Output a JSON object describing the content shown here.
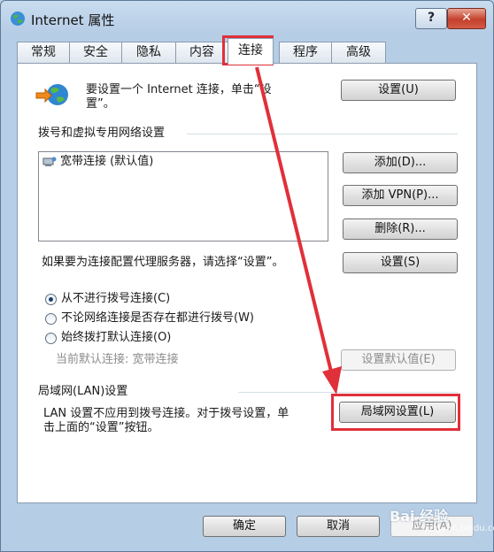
{
  "window": {
    "title": "Internet 属性",
    "help_label": "?",
    "close_label": "✕"
  },
  "tabs": [
    {
      "label": "常规"
    },
    {
      "label": "安全"
    },
    {
      "label": "隐私"
    },
    {
      "label": "内容"
    },
    {
      "label": "连接",
      "active": true
    },
    {
      "label": "程序"
    },
    {
      "label": "高级"
    }
  ],
  "setup": {
    "text_line1": "要设置一个 Internet 连接，单击“设",
    "text_line2": "置”。",
    "button": "设置(U)"
  },
  "dialup": {
    "heading": "拨号和虚拟专用网络设置",
    "list_items": [
      {
        "label": "宽带连接 (默认值)"
      }
    ],
    "add_button": "添加(D)...",
    "add_vpn_button": "添加 VPN(P)...",
    "remove_button": "删除(R)...",
    "proxy_text": "如果要为连接配置代理服务器，请选择“设置”。",
    "settings_button": "设置(S)",
    "radio_options": [
      {
        "label": "从不进行拨号连接(C)",
        "checked": true
      },
      {
        "label": "不论网络连接是否存在都进行拨号(W)",
        "checked": false
      },
      {
        "label": "始终拨打默认连接(O)",
        "checked": false
      }
    ],
    "current_default": "当前默认连接: 宽带连接",
    "set_default_button": "设置默认值(E)"
  },
  "lan": {
    "heading": "局域网(LAN)设置",
    "text_line1": "LAN 设置不应用到拨号连接。对于拨号设置，单",
    "text_line2": "击上面的“设置”按钮。",
    "button": "局域网设置(L)"
  },
  "footer": {
    "ok": "确定",
    "cancel": "取消",
    "apply": "应用(A)"
  },
  "watermark": {
    "main": "Bai 经验",
    "sub": "jingyan.baidu.com"
  },
  "annotation_color": "#e0303a"
}
